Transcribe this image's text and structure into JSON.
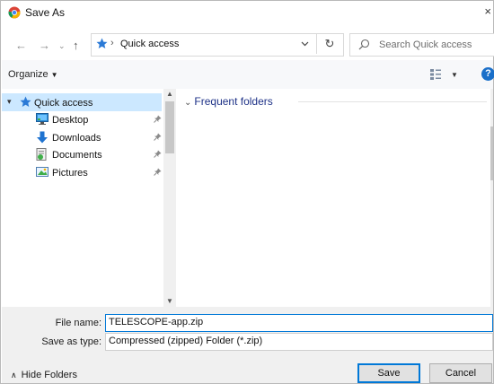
{
  "window": {
    "title": "Save As",
    "close_glyph": "×"
  },
  "address": {
    "crumb": "Quick access",
    "separator": "›"
  },
  "search": {
    "placeholder": "Search Quick access"
  },
  "toolbar": {
    "organize_label": "Organize",
    "help_label": "?"
  },
  "nav": {
    "items": [
      {
        "label": "Quick access",
        "icon": "star-icon",
        "selected": true
      },
      {
        "label": "Desktop",
        "icon": "desktop-icon",
        "pinned": true
      },
      {
        "label": "Downloads",
        "icon": "download-arrow-icon",
        "pinned": true
      },
      {
        "label": "Documents",
        "icon": "documents-icon",
        "pinned": true
      },
      {
        "label": "Pictures",
        "icon": "pictures-icon",
        "pinned": true
      }
    ]
  },
  "content": {
    "group_header": "Frequent folders"
  },
  "form": {
    "file_name_label": "File name:",
    "file_name_value": "TELESCOPE-app.zip",
    "save_type_label": "Save as type:",
    "save_type_value": "Compressed (zipped) Folder (*.zip)"
  },
  "footer": {
    "hide_folders_label": "Hide Folders",
    "save_label": "Save",
    "cancel_label": "Cancel"
  },
  "colors": {
    "accent": "#0078d7",
    "selection": "#cce8ff",
    "group_header": "#1e3287",
    "star": "#2b7ad6"
  }
}
